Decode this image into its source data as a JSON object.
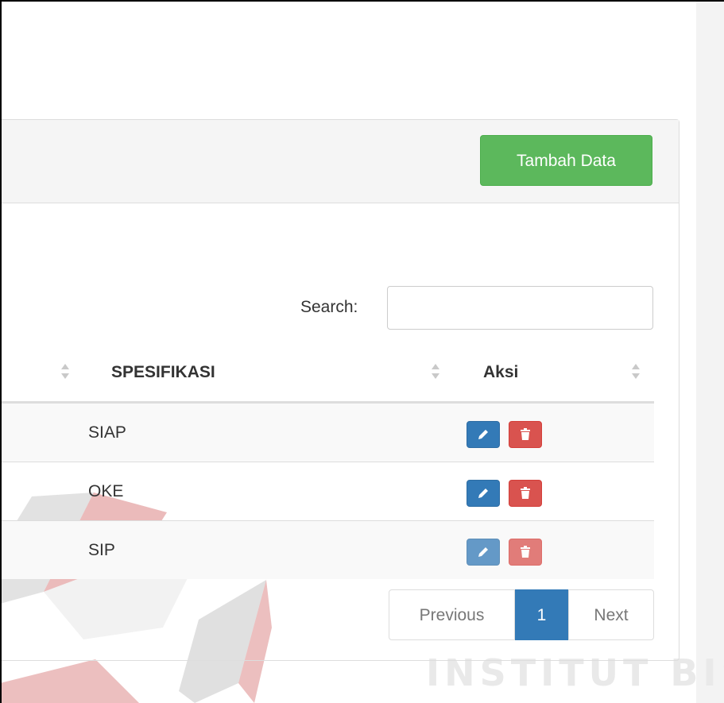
{
  "panel": {
    "add_button_label": "Tambah Data"
  },
  "search": {
    "label": "Search:",
    "value": "",
    "placeholder": ""
  },
  "table": {
    "columns": [
      "SPESIFIKASI",
      "Aksi"
    ],
    "rows": [
      {
        "spesifikasi": "SIAP"
      },
      {
        "spesifikasi": "OKE"
      },
      {
        "spesifikasi": "SIP"
      }
    ]
  },
  "pagination": {
    "previous_label": "Previous",
    "current_page": "1",
    "next_label": "Next"
  },
  "watermark": {
    "text": "INSTITUT BISNIS"
  },
  "colors": {
    "success": "#5cb85c",
    "primary": "#337ab7",
    "danger": "#d9534f"
  },
  "icons": {
    "edit": "pencil-icon",
    "delete": "trash-icon",
    "sort": "sort-icon"
  }
}
